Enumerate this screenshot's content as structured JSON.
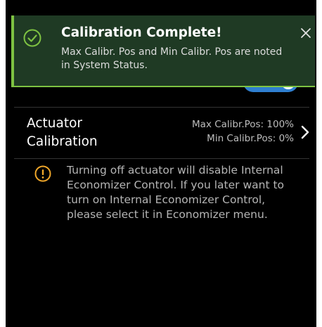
{
  "toast": {
    "title": "Calibration Complete!",
    "message": "Max Calibr. Pos and Min Calibr. Pos are noted in System Status.",
    "icon": "check-circle-icon",
    "close_icon": "close-icon",
    "accent_color": "#7ec242",
    "background_color": "#1f3a24"
  },
  "toggle": {
    "state": "on",
    "color": "#2f7fd0"
  },
  "actuator_row": {
    "title": "Actuator Calibration",
    "max_value": "Max Calibr.Pos: 100%",
    "min_value": "Min Calibr.Pos: 0%",
    "chevron_icon": "chevron-right-icon"
  },
  "warning": {
    "icon": "warning-icon",
    "icon_color": "#f0a72a",
    "text": "Turning off actuator will disable Internal Economizer Control. If you later want to turn on Internal Economizer Control, please select it in Economizer menu."
  }
}
